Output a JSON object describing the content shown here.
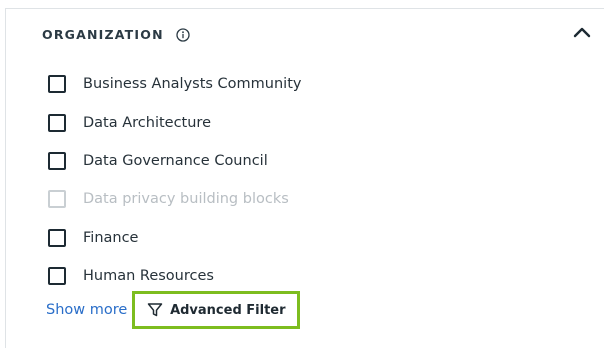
{
  "section": {
    "title": "ORGANIZATION",
    "info_icon": "info-circle-icon",
    "collapse_icon": "chevron-up-icon"
  },
  "options": [
    {
      "label": "Business Analysts Community",
      "checked": false,
      "disabled": false
    },
    {
      "label": "Data Architecture",
      "checked": false,
      "disabled": false
    },
    {
      "label": "Data Governance Council",
      "checked": false,
      "disabled": false
    },
    {
      "label": "Data privacy building blocks",
      "checked": false,
      "disabled": true
    },
    {
      "label": "Finance",
      "checked": false,
      "disabled": false
    },
    {
      "label": "Human Resources",
      "checked": false,
      "disabled": false
    }
  ],
  "footer": {
    "show_more_label": "Show more",
    "advanced_filter_label": "Advanced Filter",
    "advanced_filter_icon": "filter-icon"
  },
  "colors": {
    "link": "#2a6ec9",
    "highlight_border": "#7dbd1f",
    "disabled_text": "#b8bec3"
  }
}
